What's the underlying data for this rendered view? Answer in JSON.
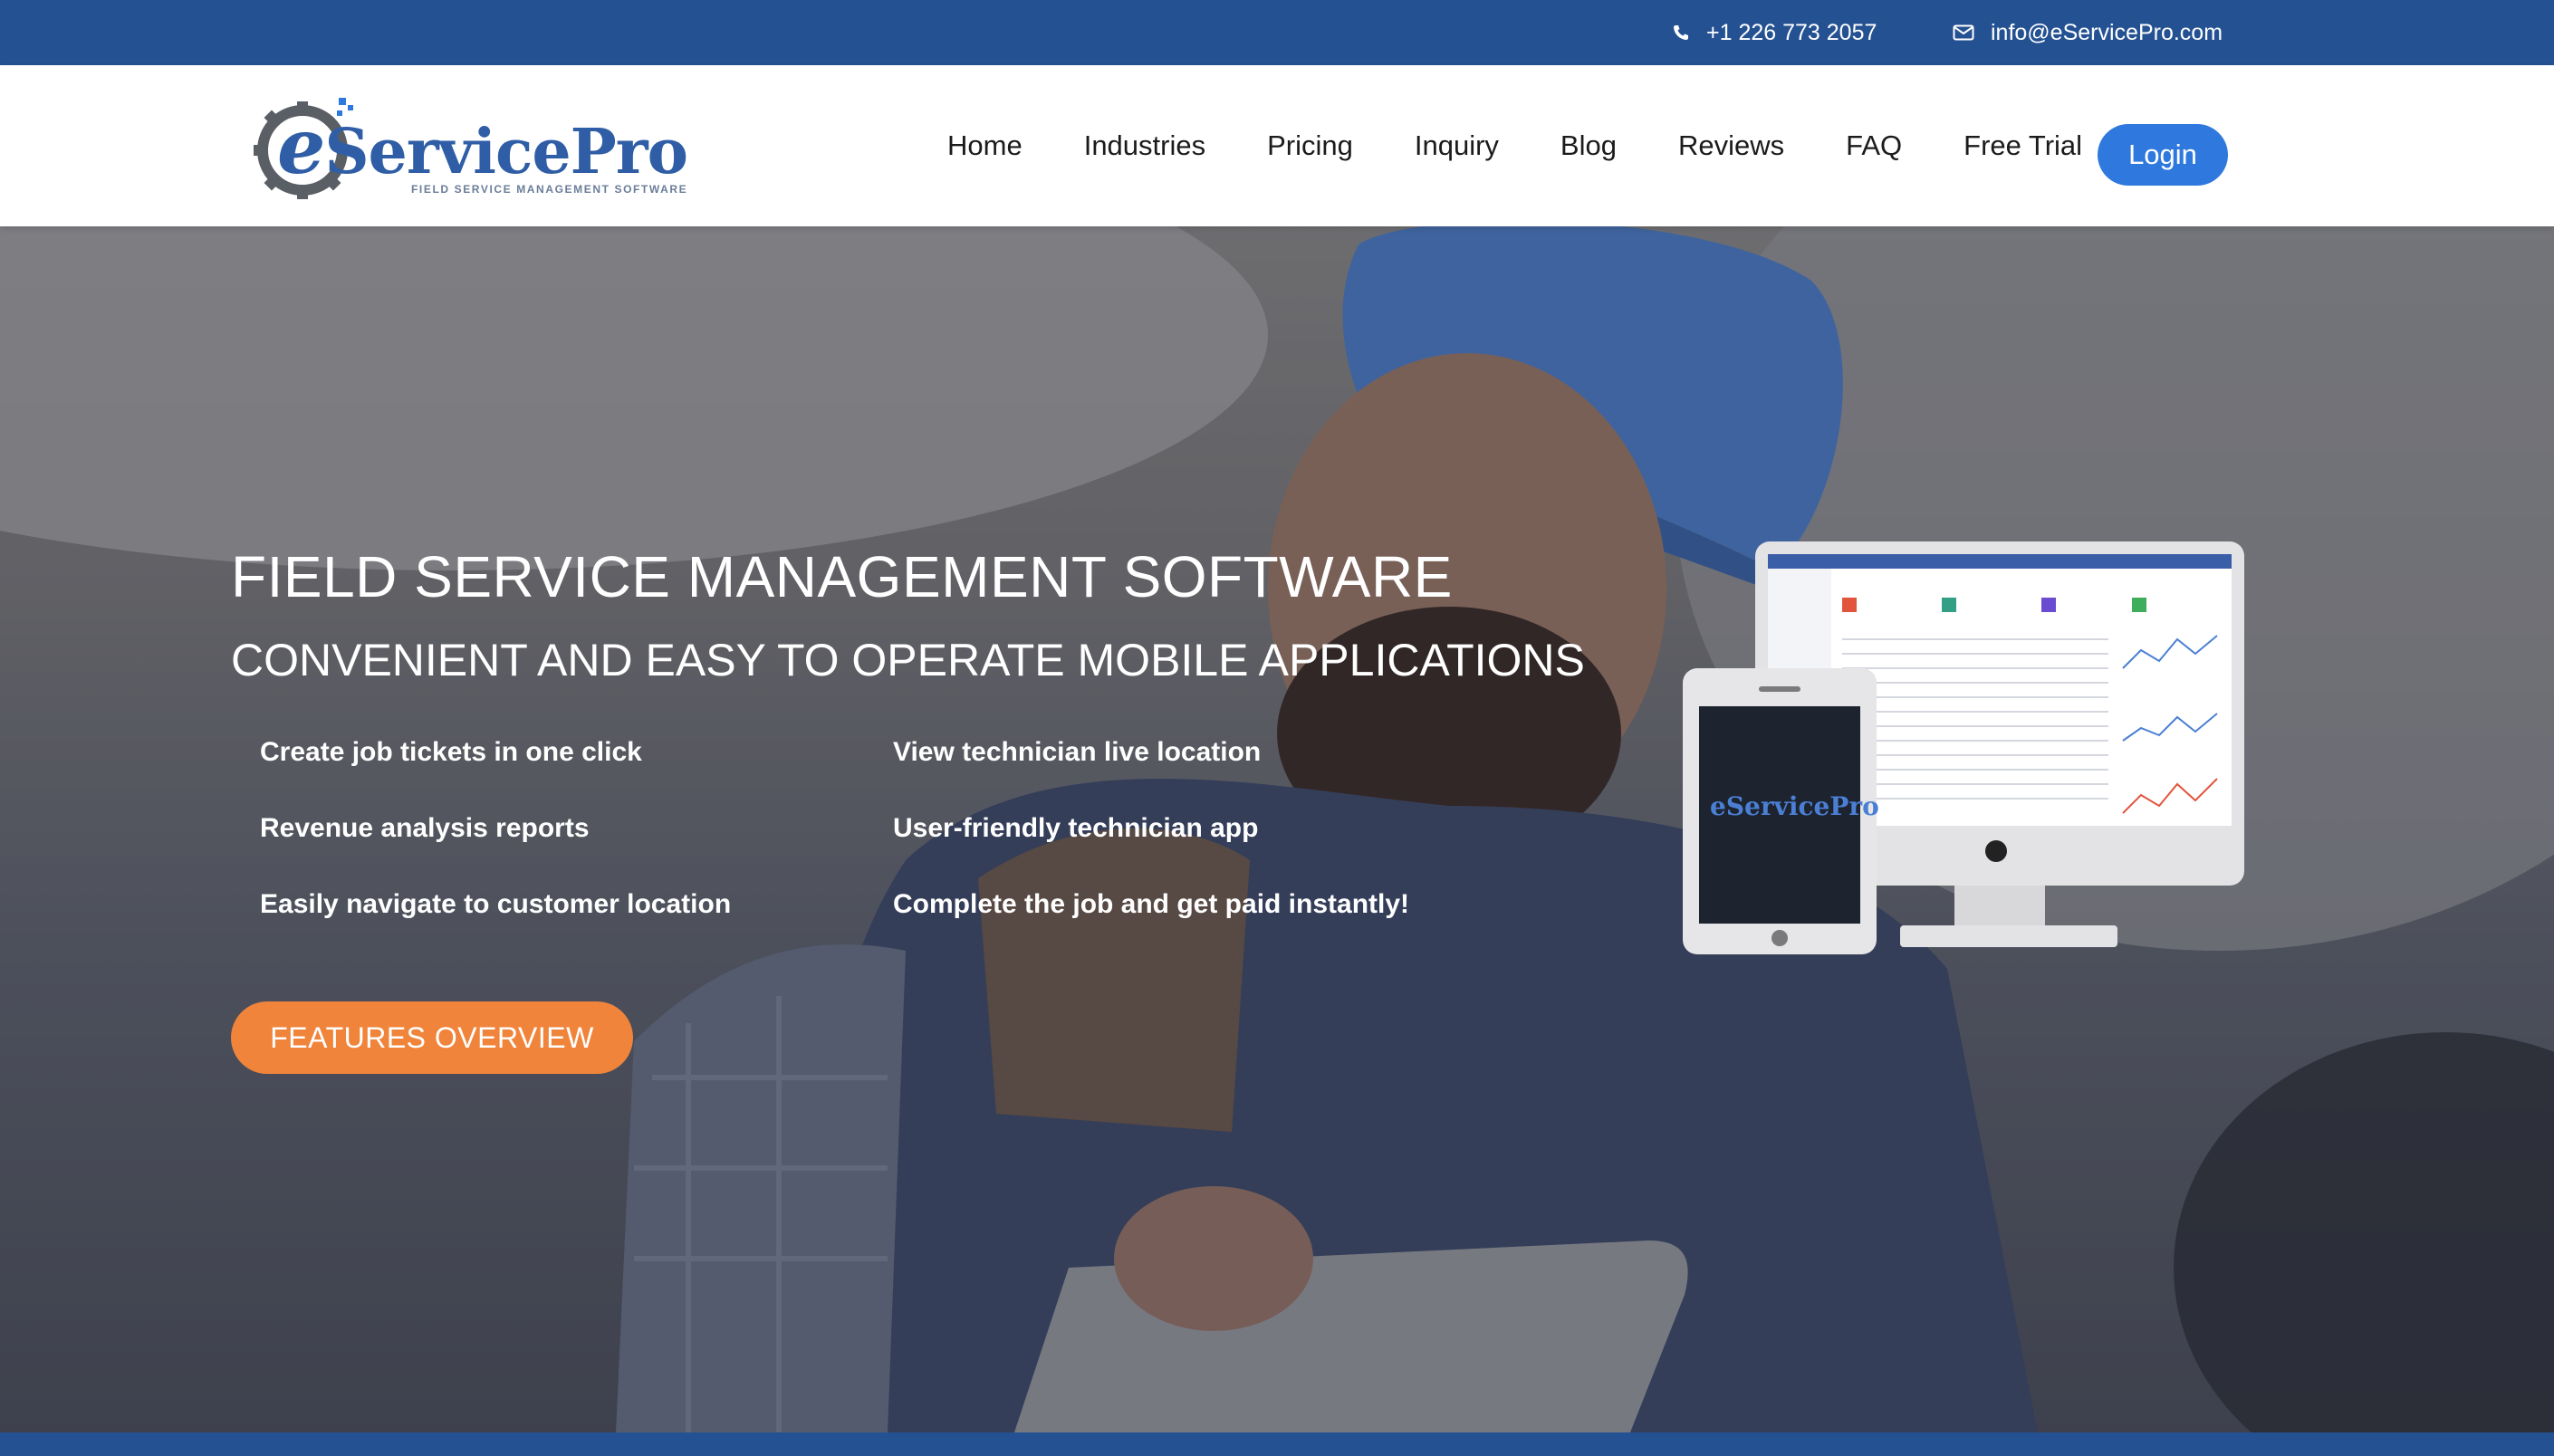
{
  "topbar": {
    "phone": "+1 226 773 2057",
    "email": "info@eServicePro.com",
    "background": "#245192"
  },
  "logo": {
    "brand_e": "e",
    "brand_service": "Service",
    "brand_pro": "Pro",
    "tagline": "FIELD SERVICE MANAGEMENT SOFTWARE"
  },
  "nav": {
    "items": [
      "Home",
      "Industries",
      "Pricing",
      "Inquiry",
      "Blog",
      "Reviews",
      "FAQ",
      "Free Trial"
    ],
    "login": "Login",
    "login_color": "#2f79de"
  },
  "hero": {
    "title": "FIELD SERVICE MANAGEMENT SOFTWARE",
    "subtitle": "CONVENIENT AND EASY TO OPERATE MOBILE APPLICATIONS",
    "features_left": [
      "Create job tickets in one click",
      "Revenue analysis reports",
      "Easily navigate to customer location"
    ],
    "features_right": [
      "View technician live location",
      "User-friendly technician app",
      "Complete the job and get paid instantly!"
    ],
    "cta": "FEATURES OVERVIEW",
    "cta_color": "#f0843b"
  },
  "icons": {
    "phone": "phone-icon",
    "email": "envelope-icon"
  }
}
